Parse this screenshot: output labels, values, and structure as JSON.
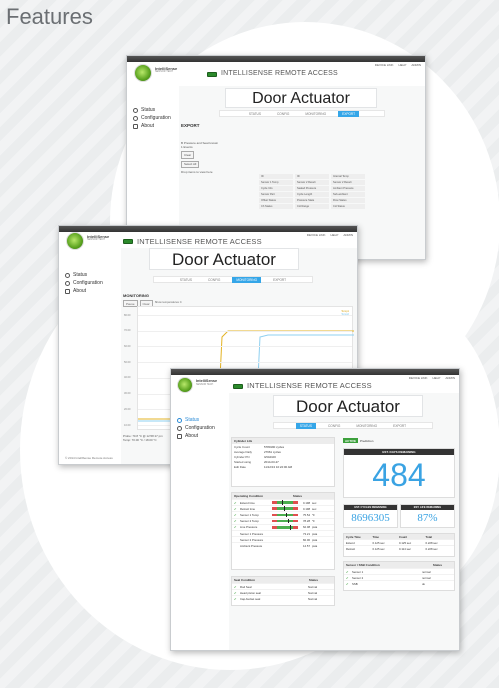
{
  "page": {
    "title": "Features"
  },
  "common": {
    "brand": "IntelliSense",
    "brand_sub": "SENSOR TECH",
    "app_title": "INTELLISENSE REMOTE ACCESS",
    "device": "Door Actuator",
    "util": [
      "DEVICE LINK",
      "HELP",
      "ADMIN"
    ],
    "sidebar": [
      "Status",
      "Configuration",
      "About"
    ],
    "tabs": [
      "STATUS",
      "CONFIG",
      "MONITORING",
      "EXPORT"
    ],
    "footer": "© 2014 IntelliSense Remote Access"
  },
  "export": {
    "section": "EXPORT",
    "line1": "B Pressure and Seat known",
    "line2": "1 Events",
    "btn1": "Clear",
    "btn2": "Select All",
    "label": "Drop items to view here",
    "items": [
      "ID",
      "ID",
      "Internal Temp",
      "Sensor 1 Temp",
      "Sensor 2 Result",
      "Sensor 2 Result",
      "Cycle Info",
      "Sealed Pressure",
      "Ambient Pressure",
      "Sensor Part",
      "Cycle Length",
      "Sub-ambient",
      "Offset Status",
      "Pressure State",
      "Flow Status",
      "Ch Status",
      "CH Range",
      "CH Status"
    ]
  },
  "monitoring": {
    "section": "MONITORING",
    "pause": "Pause",
    "clear": "Clear",
    "legend_hint": "Show temperatures C",
    "series": [
      "Temp1",
      "Temp2"
    ],
    "y_ticks": [
      "80.00",
      "70.00",
      "60.00",
      "50.00",
      "40.00",
      "30.00",
      "20.00",
      "10.00"
    ],
    "x_label": "14:30:00",
    "readout1": "Probe: 70.8 °C @ 12:58:17 pm",
    "readout2": "Temp: 70.00 °C / 18.00 °C"
  },
  "status": {
    "cylinder_life": {
      "title": "Cylinder Life",
      "rows": [
        [
          "Cycle Count",
          "5780190 cycles"
        ],
        [
          "Average Daily",
          "27661 cycles"
        ],
        [
          "Cylinder PN",
          "G542100"
        ],
        [
          "Started using",
          "2014-03-27"
        ],
        [
          "Edit Date",
          "11/12/13 10:22:00 AM"
        ]
      ]
    },
    "operating": {
      "title": "Operating Condition",
      "status_head": "Status",
      "rows": [
        {
          "label": "Extend time",
          "value": "0.198",
          "unit": "sec"
        },
        {
          "label": "Retract time",
          "value": "0.198",
          "unit": "sec"
        },
        {
          "label": "Sensor 1 Temp",
          "value": "75.54",
          "unit": "°F"
        },
        {
          "label": "Sensor 2 Temp",
          "value": "78.28",
          "unit": "°F"
        },
        {
          "label": "Line Pressure",
          "value": "62.08",
          "unit": "psia"
        },
        {
          "label": "Sensor 1 Pressure",
          "value": "73.21",
          "unit": "psia"
        },
        {
          "label": "Sensor 2 Pressure",
          "value": "82.00",
          "unit": "psia"
        },
        {
          "label": "Ambient Pressure",
          "value": "14.57",
          "unit": "psia"
        }
      ]
    },
    "seal": {
      "title": "Seal Condition",
      "status_head": "Status",
      "rows": [
        [
          "Rod Seal",
          "Normal"
        ],
        [
          "Head piston seal",
          "Normal"
        ],
        [
          "Cap-bucket seal",
          "Normal"
        ]
      ]
    },
    "badge": "ACTIVE",
    "badge_text": "Prediction",
    "est_days": {
      "title": "EST. DAYS REMAINING",
      "value": "484"
    },
    "cycles_rem": {
      "title": "EST. CYCLES REMAINING",
      "value": "8696305"
    },
    "life_rem": {
      "title": "EST. LIFE REMAINING",
      "value": "87%"
    },
    "cycle_time": {
      "head": [
        "Cycle Time",
        "Time",
        "Count",
        "Total"
      ],
      "rows": [
        [
          "Extend",
          "0.125 sec",
          "0.125 sec",
          "0.228 sec"
        ],
        [
          "Retract",
          "0.125 sec",
          "0.114 sec",
          "0.228 sec"
        ]
      ]
    },
    "sensor": {
      "title": "Sensor / SSB Condition",
      "status_head": "Status",
      "rows": [
        [
          "Sensor 1",
          "normal"
        ],
        [
          "Sensor 2",
          "normal"
        ],
        [
          "SSB",
          "ok"
        ]
      ]
    }
  },
  "colors": {
    "accent": "#35a6e8",
    "brand_green": "#5aa21f",
    "ok": "#3ca03c",
    "warn": "#e05050"
  }
}
